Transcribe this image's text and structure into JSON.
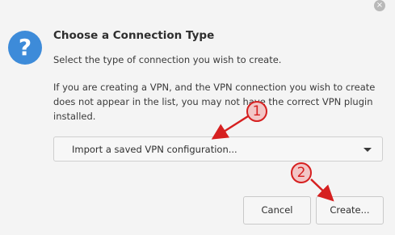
{
  "dialog": {
    "title": "Choose a Connection Type",
    "subtitle": "Select the type of connection you wish to create.",
    "info": "If you are creating a VPN, and the VPN connection you wish to create does not appear in the list, you may not have the correct VPN plugin installed.",
    "icon": "question-icon",
    "close_glyph": "×"
  },
  "connection_type": {
    "selected": "Import a saved VPN configuration..."
  },
  "buttons": {
    "cancel": "Cancel",
    "create": "Create..."
  },
  "annotations": [
    {
      "label": "1",
      "color": "#d62020"
    },
    {
      "label": "2",
      "color": "#d62020"
    }
  ],
  "colors": {
    "accent": "#3d8bd9",
    "annotation": "#d62020",
    "background": "#f4f4f4"
  }
}
